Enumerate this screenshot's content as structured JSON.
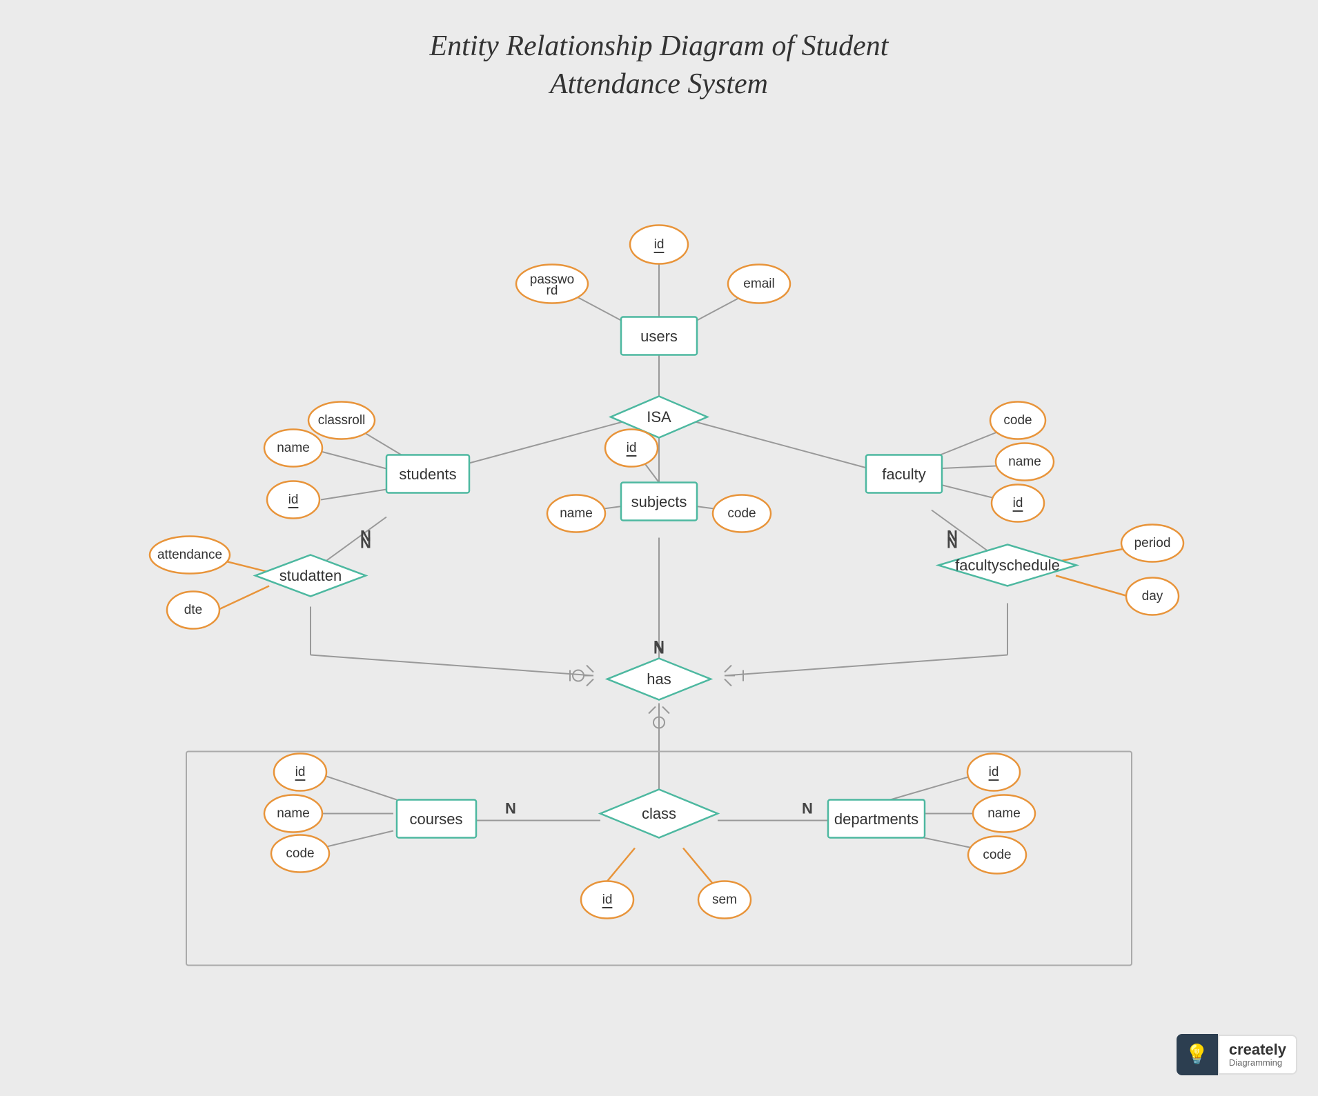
{
  "title": {
    "line1": "Entity Relationship Diagram of Student",
    "line2": "Attendance System"
  },
  "entities": {
    "users": "users",
    "students": "students",
    "faculty": "faculty",
    "subjects": "subjects",
    "courses": "courses",
    "departments": "departments",
    "class": "class"
  },
  "relationships": {
    "isa": "ISA",
    "studatten": "studatten",
    "facultyschedule": "facultyschedule",
    "has": "has"
  },
  "attributes": {
    "users_id": "id",
    "users_password": "password",
    "users_email": "email",
    "students_name": "name",
    "students_id": "id",
    "students_classroll": "classroll",
    "faculty_code": "code",
    "faculty_name": "name",
    "faculty_id": "id",
    "subjects_id": "id",
    "subjects_name": "name",
    "subjects_code": "code",
    "studatten_attendance": "attendance",
    "studatten_dte": "dte",
    "facultyschedule_period": "period",
    "facultyschedule_day": "day",
    "courses_id": "id",
    "courses_name": "name",
    "courses_code": "code",
    "departments_id": "id",
    "departments_name": "name",
    "departments_code": "code",
    "class_id": "id",
    "class_sem": "sem"
  },
  "multiplicities": {
    "N1": "N",
    "N2": "N",
    "N3": "N",
    "N4": "N"
  },
  "creately": {
    "bulb": "💡",
    "main": "creately",
    "sub": "Diagramming"
  }
}
